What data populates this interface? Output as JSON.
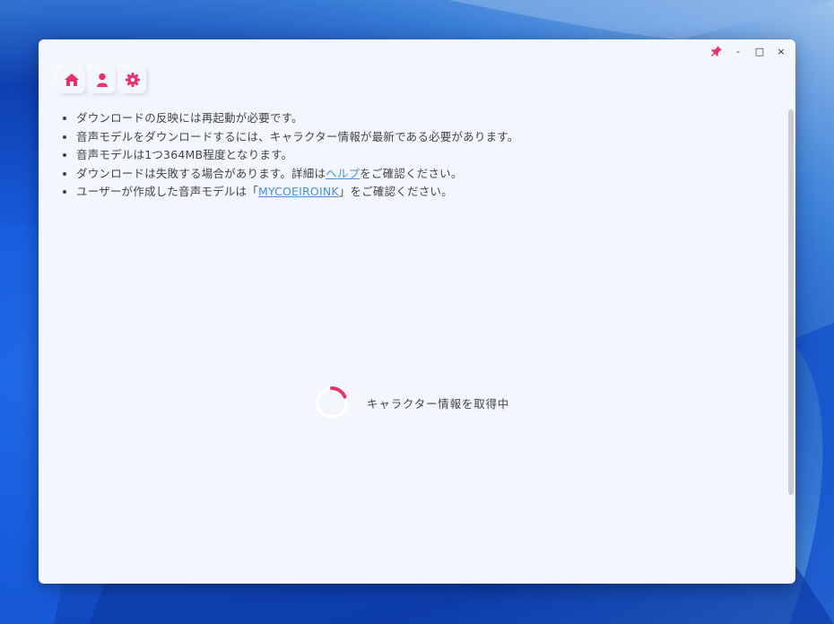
{
  "window": {
    "controls": {
      "pin_icon": "pin-icon",
      "minimize": "-",
      "maximize": "□",
      "close": "×"
    }
  },
  "nav": {
    "items": [
      {
        "icon": "home-icon"
      },
      {
        "icon": "user-icon"
      },
      {
        "icon": "gear-icon"
      }
    ]
  },
  "notes": {
    "item1": "ダウンロードの反映には再起動が必要です。",
    "item2": "音声モデルをダウンロードするには、キャラクター情報が最新である必要があります。",
    "item3": "音声モデルは1つ364MB程度となります。",
    "item4_before": "ダウンロードは失敗する場合があります。詳細は",
    "item4_link": "ヘルプ",
    "item4_after": "をご確認ください。",
    "item5_before": "ユーザーが作成した音声モデルは「",
    "item5_link": "MYCOEIROINK",
    "item5_after": "」をご確認ください。"
  },
  "loading": {
    "text": "キャラクター情報を取得中"
  },
  "colors": {
    "accent": "#e8336a",
    "link": "#4a8fd8",
    "window_bg": "#f3f6fd"
  }
}
